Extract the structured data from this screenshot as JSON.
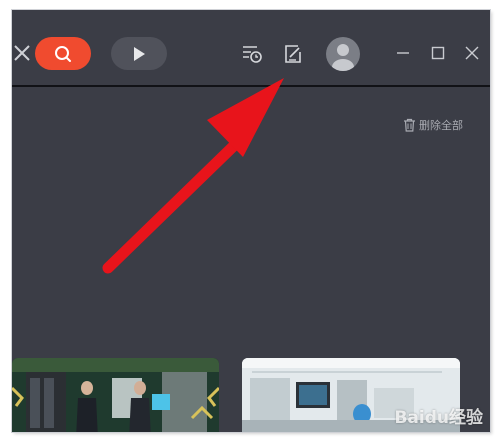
{
  "toolbar": {
    "close_icon": "close-icon",
    "search_icon": "search-icon",
    "play_icon": "play-icon",
    "history_icon": "history-icon",
    "edit_icon": "edit-icon",
    "avatar_icon": "user-avatar-icon",
    "minimize_icon": "minimize-icon",
    "maximize_icon": "maximize-icon",
    "window_close_icon": "close-icon"
  },
  "main": {
    "delete_all_label": "删除全部",
    "delete_icon": "trash-icon"
  },
  "thumbnails": [
    {
      "name": "video-thumbnail-1"
    },
    {
      "name": "video-thumbnail-2"
    }
  ],
  "watermark": "Baidu经验",
  "colors": {
    "background": "#3b3d46",
    "accent_search": "#f04b2f",
    "annotation_arrow": "#e8141b"
  }
}
